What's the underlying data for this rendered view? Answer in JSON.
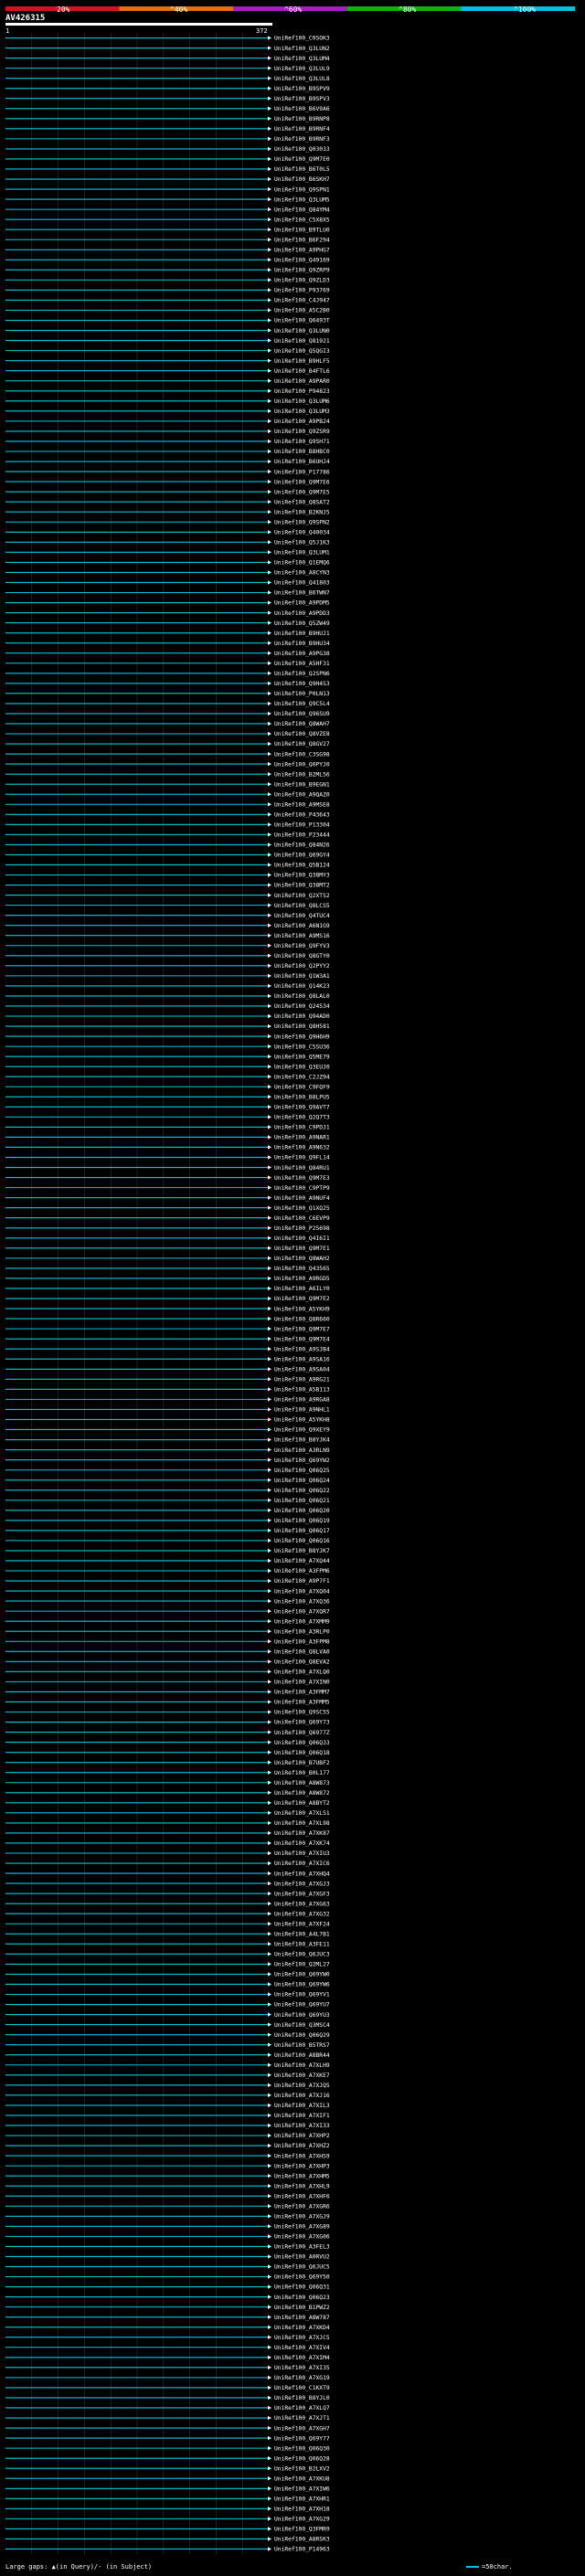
{
  "query": {
    "id": "AV426315",
    "start": "1",
    "end": "372"
  },
  "scale_labels": [
    "20%",
    "^40%",
    "^60%",
    "^80%",
    "^100%"
  ],
  "footer": {
    "gaps_text": "Large gaps: ▲(in Query)/- (in Subject)",
    "scale_text": "=50char."
  },
  "chart_data": {
    "type": "alignment",
    "query_length": 372,
    "hits": [
      {
        "label": "UniRef100_C0SOK3"
      },
      {
        "label": "UniRef100_Q3LUN2"
      },
      {
        "label": "UniRef100_Q3LUM4"
      },
      {
        "label": "UniRef100_Q3LUL9"
      },
      {
        "label": "UniRef100_Q3LUL8"
      },
      {
        "label": "UniRef100_B9SPV9"
      },
      {
        "label": "UniRef100_B9SPV3"
      },
      {
        "label": "UniRef100_B6V9A6"
      },
      {
        "label": "UniRef100_B9RNP8"
      },
      {
        "label": "UniRef100_B9RNF4"
      },
      {
        "label": "UniRef100_B9RNF3"
      },
      {
        "label": "UniRef100_Q03033"
      },
      {
        "label": "UniRef100_Q9M7E0"
      },
      {
        "label": "UniRef100_B6T0L5"
      },
      {
        "label": "UniRef100_B6SKH7"
      },
      {
        "label": "UniRef100_Q9SPN1"
      },
      {
        "label": "UniRef100_Q3LUM5"
      },
      {
        "label": "UniRef100_Q84YM4"
      },
      {
        "label": "UniRef100_C5X8X5"
      },
      {
        "label": "UniRef100_B9TLU0"
      },
      {
        "label": "UniRef100_B6F294"
      },
      {
        "label": "UniRef100_A9PHG7"
      },
      {
        "label": "UniRef100_Q49169"
      },
      {
        "label": "UniRef100_Q9ZRP9"
      },
      {
        "label": "UniRef100_Q9ZLD3"
      },
      {
        "label": "UniRef100_P93769"
      },
      {
        "label": "UniRef100_C4J947"
      },
      {
        "label": "UniRef100_A5C2B0"
      },
      {
        "label": "UniRef100_Q6493T"
      },
      {
        "label": "UniRef100_Q3LUN0"
      },
      {
        "label": "UniRef100_Q81921"
      },
      {
        "label": "UniRef100_Q5QGI3"
      },
      {
        "label": "UniRef100_B9HLF5"
      },
      {
        "label": "UniRef100_B4FTL6"
      },
      {
        "label": "UniRef100_A9PAR0"
      },
      {
        "label": "UniRef100_P94823"
      },
      {
        "label": "UniRef100_Q3LUM6"
      },
      {
        "label": "UniRef100_Q3LUM3"
      },
      {
        "label": "UniRef100_A9PB24"
      },
      {
        "label": "UniRef100_Q9ZSR9"
      },
      {
        "label": "UniRef100_Q9SH71"
      },
      {
        "label": "UniRef100_B8HBC0"
      },
      {
        "label": "UniRef100_B6UHJ4"
      },
      {
        "label": "UniRef100_P17786"
      },
      {
        "label": "UniRef100_Q9M7E6"
      },
      {
        "label": "UniRef100_Q9M7E5"
      },
      {
        "label": "UniRef100_Q8SAT2"
      },
      {
        "label": "UniRef100_B2KNJ5"
      },
      {
        "label": "UniRef100_Q9SPN2"
      },
      {
        "label": "UniRef100_Q40034"
      },
      {
        "label": "UniRef100_Q5J1K3"
      },
      {
        "label": "UniRef100_Q3LUM1"
      },
      {
        "label": "UniRef100_Q1EMQ6"
      },
      {
        "label": "UniRef100_A8CYN3"
      },
      {
        "label": "UniRef100_Q41803"
      },
      {
        "label": "UniRef100_B6TWN7"
      },
      {
        "label": "UniRef100_A9PDM5"
      },
      {
        "label": "UniRef100_A9PDD3"
      },
      {
        "label": "UniRef100_Q5ZW49"
      },
      {
        "label": "UniRef100_B9HUJ1"
      },
      {
        "label": "UniRef100_B9HU34"
      },
      {
        "label": "UniRef100_A9PG38"
      },
      {
        "label": "UniRef100_A5HF31"
      },
      {
        "label": "UniRef100_Q2SPN6"
      },
      {
        "label": "UniRef100_Q9H4S3"
      },
      {
        "label": "UniRef100_P0LN13"
      },
      {
        "label": "UniRef100_Q9C5L4"
      },
      {
        "label": "UniRef100_Q96SU9"
      },
      {
        "label": "UniRef100_Q8WAH7"
      },
      {
        "label": "UniRef100_Q8VZE8"
      },
      {
        "label": "UniRef100_Q8GV27"
      },
      {
        "label": "UniRef100_C3SG98"
      },
      {
        "label": "UniRef100_Q0PYJ0"
      },
      {
        "label": "UniRef100_B2ML56"
      },
      {
        "label": "UniRef100_B9EGN1"
      },
      {
        "label": "UniRef100_A9QAZ0"
      },
      {
        "label": "UniRef100_A9MSE8"
      },
      {
        "label": "UniRef100_P43643"
      },
      {
        "label": "UniRef100_P13304"
      },
      {
        "label": "UniRef100_P23444"
      },
      {
        "label": "UniRef100_Q84N26"
      },
      {
        "label": "UniRef100_Q69GY4"
      },
      {
        "label": "UniRef100_Q5B124"
      },
      {
        "label": "UniRef100_Q38MY3"
      },
      {
        "label": "UniRef100_Q38MT2"
      },
      {
        "label": "UniRef100_Q2XTS2"
      },
      {
        "label": "UniRef100_Q8LCS5"
      },
      {
        "label": "UniRef100_Q4TUC4"
      },
      {
        "label": "UniRef100_A6N1G9"
      },
      {
        "label": "UniRef100_A9MS16"
      },
      {
        "label": "UniRef100_Q9FYV3"
      },
      {
        "label": "UniRef100_Q8GTY0"
      },
      {
        "label": "UniRef100_Q2PYY2"
      },
      {
        "label": "UniRef100_Q1W3A1"
      },
      {
        "label": "UniRef100_Q14K23"
      },
      {
        "label": "UniRef100_Q8LAL0"
      },
      {
        "label": "UniRef100_Q24534"
      },
      {
        "label": "UniRef100_Q94AD0"
      },
      {
        "label": "UniRef100_Q8H581"
      },
      {
        "label": "UniRef100_Q9H6H9"
      },
      {
        "label": "UniRef100_C5SU36"
      },
      {
        "label": "UniRef100_Q5ME79"
      },
      {
        "label": "UniRef100_Q3EUJ0"
      },
      {
        "label": "UniRef100_C2JZ94"
      },
      {
        "label": "UniRef100_C9FQF9"
      },
      {
        "label": "UniRef100_B8LPU5"
      },
      {
        "label": "UniRef100_Q9AVT7"
      },
      {
        "label": "UniRef100_Q2Q7T3"
      },
      {
        "label": "UniRef100_C9PDJ1"
      },
      {
        "label": "UniRef100_A9NAR1"
      },
      {
        "label": "UniRef100_A9N632"
      },
      {
        "label": "UniRef100_Q9FL14"
      },
      {
        "label": "UniRef100_Q84RU1"
      },
      {
        "label": "UniRef100_Q9M7E3"
      },
      {
        "label": "UniRef100_C9PTP9"
      },
      {
        "label": "UniRef100_A9NUF4"
      },
      {
        "label": "UniRef100_Q1XQ25"
      },
      {
        "label": "UniRef100_C6EVP9"
      },
      {
        "label": "UniRef100_P25698"
      },
      {
        "label": "UniRef100_Q4I6I1"
      },
      {
        "label": "UniRef100_Q9M7E1"
      },
      {
        "label": "UniRef100_Q8WAH2"
      },
      {
        "label": "UniRef100_Q43565"
      },
      {
        "label": "UniRef100_A9RGD5"
      },
      {
        "label": "UniRef100_A6ILY0"
      },
      {
        "label": "UniRef100_Q9M7E2"
      },
      {
        "label": "UniRef100_A5YKH9"
      },
      {
        "label": "UniRef100_Q8R660"
      },
      {
        "label": "UniRef100_Q9M7E7"
      },
      {
        "label": "UniRef100_Q9M7E4"
      },
      {
        "label": "UniRef100_A9SJB4"
      },
      {
        "label": "UniRef100_A9SA16"
      },
      {
        "label": "UniRef100_A9SA04"
      },
      {
        "label": "UniRef100_A9RG21"
      },
      {
        "label": "UniRef100_A5B113"
      },
      {
        "label": "UniRef100_A9RGA8"
      },
      {
        "label": "UniRef100_A9NHL1"
      },
      {
        "label": "UniRef100_A5YKH8"
      },
      {
        "label": "UniRef100_Q9XEY9"
      },
      {
        "label": "UniRef100_B8YJK4"
      },
      {
        "label": "UniRef100_A3RLN9"
      },
      {
        "label": "UniRef100_Q69YW2"
      },
      {
        "label": "UniRef100_Q06Q25"
      },
      {
        "label": "UniRef100_Q06Q24"
      },
      {
        "label": "UniRef100_Q06Q22"
      },
      {
        "label": "UniRef100_Q06Q21"
      },
      {
        "label": "UniRef100_Q06Q20"
      },
      {
        "label": "UniRef100_Q06Q19"
      },
      {
        "label": "UniRef100_Q06Q17"
      },
      {
        "label": "UniRef100_Q06Q16"
      },
      {
        "label": "UniRef100_B8YJK7"
      },
      {
        "label": "UniRef100_A7XQ44"
      },
      {
        "label": "UniRef100_A3FPM6"
      },
      {
        "label": "UniRef100_A9P7F1"
      },
      {
        "label": "UniRef100_A7XQ04"
      },
      {
        "label": "UniRef100_A7XQ36"
      },
      {
        "label": "UniRef100_A7XQR7"
      },
      {
        "label": "UniRef100_A7XMM9"
      },
      {
        "label": "UniRef100_A3RLP0"
      },
      {
        "label": "UniRef100_A3FPM8"
      },
      {
        "label": "UniRef100_Q8LVA0"
      },
      {
        "label": "UniRef100_Q8EVA2"
      },
      {
        "label": "UniRef100_A7XLQ0"
      },
      {
        "label": "UniRef100_A7XIN0"
      },
      {
        "label": "UniRef100_A3FMM7"
      },
      {
        "label": "UniRef100_A3FMM5"
      },
      {
        "label": "UniRef100_Q9SC55"
      },
      {
        "label": "UniRef100_Q69Y73"
      },
      {
        "label": "UniRef100_Q6977Z"
      },
      {
        "label": "UniRef100_Q06Q33"
      },
      {
        "label": "UniRef100_Q06Q18"
      },
      {
        "label": "UniRef100_B7UBF2"
      },
      {
        "label": "UniRef100_B0L177"
      },
      {
        "label": "UniRef100_A8W873"
      },
      {
        "label": "UniRef100_A8W872"
      },
      {
        "label": "UniRef100_A8BYT2"
      },
      {
        "label": "UniRef100_A7XLS1"
      },
      {
        "label": "UniRef100_A7XL98"
      },
      {
        "label": "UniRef100_A7XK87"
      },
      {
        "label": "UniRef100_A7XK74"
      },
      {
        "label": "UniRef100_A7XIU3"
      },
      {
        "label": "UniRef100_A7XIC6"
      },
      {
        "label": "UniRef100_A7XHQ4"
      },
      {
        "label": "UniRef100_A7XGJ3"
      },
      {
        "label": "UniRef100_A7XGF3"
      },
      {
        "label": "UniRef100_A7XG63"
      },
      {
        "label": "UniRef100_A7XG32"
      },
      {
        "label": "UniRef100_A7XF24"
      },
      {
        "label": "UniRef100_A4L7B1"
      },
      {
        "label": "UniRef100_A3FE11"
      },
      {
        "label": "UniRef100_Q6JUC3"
      },
      {
        "label": "UniRef100_Q2ML27"
      },
      {
        "label": "UniRef100_Q69YW0"
      },
      {
        "label": "UniRef100_Q69YW6"
      },
      {
        "label": "UniRef100_Q69YV1"
      },
      {
        "label": "UniRef100_Q69YU7"
      },
      {
        "label": "UniRef100_Q69YU3"
      },
      {
        "label": "UniRef100_Q3MSC4"
      },
      {
        "label": "UniRef100_Q06Q29"
      },
      {
        "label": "UniRef100_B5TRS7"
      },
      {
        "label": "UniRef100_A8BR44"
      },
      {
        "label": "UniRef100_A7XLH9"
      },
      {
        "label": "UniRef100_A7XKE7"
      },
      {
        "label": "UniRef100_A7XJQ5"
      },
      {
        "label": "UniRef100_A7XJ16"
      },
      {
        "label": "UniRef100_A7XIL3"
      },
      {
        "label": "UniRef100_A7XIF1"
      },
      {
        "label": "UniRef100_A7XI33"
      },
      {
        "label": "UniRef100_A7XHP2"
      },
      {
        "label": "UniRef100_A7XHZ2"
      },
      {
        "label": "UniRef100_A7XHS9"
      },
      {
        "label": "UniRef100_A7XHP3"
      },
      {
        "label": "UniRef100_A7XHM5"
      },
      {
        "label": "UniRef100_A7XHL9"
      },
      {
        "label": "UniRef100_A7XHF6"
      },
      {
        "label": "UniRef100_A7XGR6"
      },
      {
        "label": "UniRef100_A7XGJ9"
      },
      {
        "label": "UniRef100_A7XG89"
      },
      {
        "label": "UniRef100_A7XG06"
      },
      {
        "label": "UniRef100_A3FEL3"
      },
      {
        "label": "UniRef100_A0RVU2"
      },
      {
        "label": "UniRef100_Q6JUC5"
      },
      {
        "label": "UniRef100_Q69Y50"
      },
      {
        "label": "UniRef100_Q06Q31"
      },
      {
        "label": "UniRef100_Q06Q23"
      },
      {
        "label": "UniRef100_B1PWZ2"
      },
      {
        "label": "UniRef100_A8W787"
      },
      {
        "label": "UniRef100_A7XKD4"
      },
      {
        "label": "UniRef100_A7XJC5"
      },
      {
        "label": "UniRef100_A7XIV4"
      },
      {
        "label": "UniRef100_A7XIM4"
      },
      {
        "label": "UniRef100_A7XI35"
      },
      {
        "label": "UniRef100_A7XG19"
      },
      {
        "label": "UniRef100_C1KXT9"
      },
      {
        "label": "UniRef100_B8YJL0"
      },
      {
        "label": "UniRef100_A7XLQ7"
      },
      {
        "label": "UniRef100_A7XJT1"
      },
      {
        "label": "UniRef100_A7XGH7"
      },
      {
        "label": "UniRef100_Q69Y77"
      },
      {
        "label": "UniRef100_Q06Q30"
      },
      {
        "label": "UniRef100_Q06Q28"
      },
      {
        "label": "UniRef100_B2LXV2"
      },
      {
        "label": "UniRef100_A7XKU8"
      },
      {
        "label": "UniRef100_A7XIW6"
      },
      {
        "label": "UniRef100_A7XHR1"
      },
      {
        "label": "UniRef100_A7XH18"
      },
      {
        "label": "UniRef100_A7XG29"
      },
      {
        "label": "UniRef100_Q3FMR9"
      },
      {
        "label": "UniRef100_A8RSK3"
      },
      {
        "label": "UniRef100_P14963"
      }
    ]
  }
}
